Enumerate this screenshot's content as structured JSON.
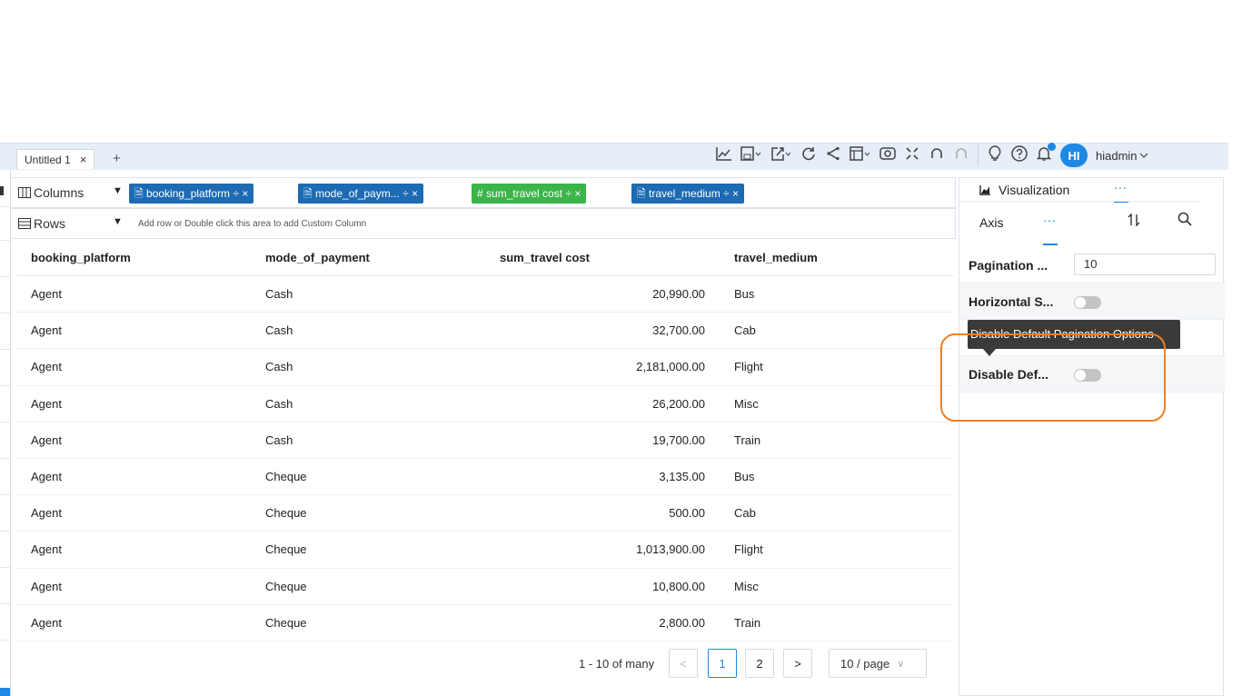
{
  "tabs": [
    {
      "label": "Untitled 1",
      "close": "×"
    }
  ],
  "add_tab": "+",
  "toolbar": {
    "icons": [
      "line-chart-icon",
      "save-icon",
      "export-icon",
      "refresh-icon",
      "share-icon",
      "layout-icon",
      "preview-icon",
      "fullscreen-icon",
      "undo-icon",
      "redo-icon",
      "lightbulb-icon",
      "help-icon",
      "bell-icon"
    ],
    "glyphs": {
      "chart": "📈",
      "save": "🖫",
      "export": "↗",
      "refresh": "⟳",
      "share": "<",
      "layout": "▤",
      "preview": "◉",
      "fullscreen": "⛶",
      "undo": "↶",
      "redo": "↷",
      "bulb": "💡",
      "help": "?",
      "bell": "🔔"
    },
    "avatar": "HI",
    "username": "hiadmin"
  },
  "columns_shelf": {
    "label": "Columns",
    "pills": [
      {
        "icon": "🗎",
        "label": "booking_platform",
        "type": "dimension",
        "color": "#1c6bb4"
      },
      {
        "icon": "🗎",
        "label": "mode_of_paym...",
        "type": "dimension",
        "color": "#1c6bb4"
      },
      {
        "icon": "#",
        "label": "sum_travel cost",
        "type": "measure",
        "color": "#3bb54a"
      },
      {
        "icon": "🗎",
        "label": "travel_medium",
        "type": "dimension",
        "color": "#1c6bb4"
      }
    ],
    "pill_suffix": "÷ ×"
  },
  "rows_shelf": {
    "label": "Rows",
    "hint": "Add row or Double click this area to add Custom Column"
  },
  "table": {
    "headers": [
      "booking_platform",
      "mode_of_payment",
      "sum_travel cost",
      "travel_medium"
    ],
    "rows": [
      [
        "Agent",
        "Cash",
        "20,990.00",
        "Bus"
      ],
      [
        "Agent",
        "Cash",
        "32,700.00",
        "Cab"
      ],
      [
        "Agent",
        "Cash",
        "2,181,000.00",
        "Flight"
      ],
      [
        "Agent",
        "Cash",
        "26,200.00",
        "Misc"
      ],
      [
        "Agent",
        "Cash",
        "19,700.00",
        "Train"
      ],
      [
        "Agent",
        "Cheque",
        "3,135.00",
        "Bus"
      ],
      [
        "Agent",
        "Cheque",
        "500.00",
        "Cab"
      ],
      [
        "Agent",
        "Cheque",
        "1,013,900.00",
        "Flight"
      ],
      [
        "Agent",
        "Cheque",
        "10,800.00",
        "Misc"
      ],
      [
        "Agent",
        "Cheque",
        "2,800.00",
        "Train"
      ]
    ]
  },
  "pagination": {
    "summary": "1 - 10 of many",
    "prev": "<",
    "pages": [
      "1",
      "2"
    ],
    "next": ">",
    "page_size": "10 / page",
    "current_page": "1"
  },
  "panel": {
    "tab_visualization": "Visualization",
    "tab_more": "···",
    "tab_axis": "Axis",
    "tab_axis_more": "···",
    "sort_glyph": "⇅",
    "search_glyph": "🔍",
    "rows": [
      {
        "label": "Pagination ...",
        "value": "10"
      },
      {
        "label": "Horizontal S...",
        "toggle": false
      },
      {
        "label": "",
        "toggle": false
      },
      {
        "label": "Disable Def...",
        "toggle": false
      }
    ],
    "tooltip": "Disable Default Pagination Options"
  },
  "colors": {
    "accent": "#1e88e5",
    "dimension_pill": "#1c6bb4",
    "measure_pill": "#3bb54a",
    "highlight": "#f07f22"
  }
}
